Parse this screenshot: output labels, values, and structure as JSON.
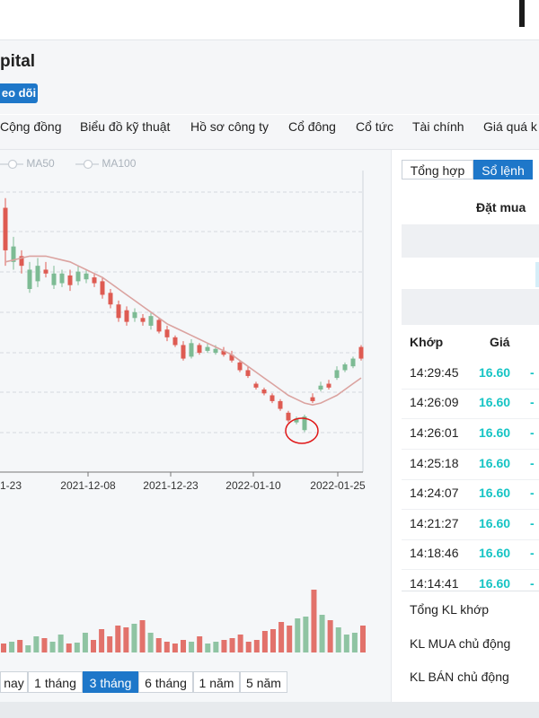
{
  "header": {
    "title_fragment": "pital",
    "follow_label": "eo dõi"
  },
  "nav": {
    "items": [
      "Cộng đồng",
      "Biểu đồ kỹ thuật",
      "Hồ sơ công ty",
      "Cổ đông",
      "Cổ tức",
      "Tài chính",
      "Giá quá k"
    ]
  },
  "legend": {
    "items": [
      "MA50",
      "MA100"
    ]
  },
  "chart_data": {
    "type": "candlestick",
    "x_ticks": [
      "1-23",
      "2021-12-08",
      "2021-12-23",
      "2022-01-10",
      "2022-01-25"
    ],
    "ylim": [
      0,
      100
    ],
    "grid": true,
    "candles": [
      {
        "o": 68,
        "c": 90,
        "h": 95,
        "l": 60,
        "up": false
      },
      {
        "o": 62,
        "c": 70,
        "h": 75,
        "l": 58,
        "up": true
      },
      {
        "o": 60,
        "c": 65,
        "h": 68,
        "l": 56,
        "up": false
      },
      {
        "o": 48,
        "c": 58,
        "h": 62,
        "l": 46,
        "up": true
      },
      {
        "o": 52,
        "c": 60,
        "h": 64,
        "l": 49,
        "up": true
      },
      {
        "o": 56,
        "c": 58,
        "h": 62,
        "l": 54,
        "up": false
      },
      {
        "o": 50,
        "c": 56,
        "h": 60,
        "l": 48,
        "up": true
      },
      {
        "o": 51,
        "c": 56,
        "h": 58,
        "l": 49,
        "up": true
      },
      {
        "o": 50,
        "c": 55,
        "h": 58,
        "l": 47,
        "up": false
      },
      {
        "o": 52,
        "c": 57,
        "h": 60,
        "l": 50,
        "up": true
      },
      {
        "o": 53,
        "c": 56,
        "h": 58,
        "l": 51,
        "up": true
      },
      {
        "o": 51,
        "c": 54,
        "h": 56,
        "l": 49,
        "up": false
      },
      {
        "o": 45,
        "c": 52,
        "h": 54,
        "l": 43,
        "up": false
      },
      {
        "o": 40,
        "c": 46,
        "h": 48,
        "l": 38,
        "up": false
      },
      {
        "o": 33,
        "c": 40,
        "h": 42,
        "l": 31,
        "up": false
      },
      {
        "o": 31,
        "c": 37,
        "h": 39,
        "l": 29,
        "up": false
      },
      {
        "o": 33,
        "c": 36,
        "h": 38,
        "l": 31,
        "up": true
      },
      {
        "o": 31,
        "c": 33,
        "h": 35,
        "l": 29,
        "up": false
      },
      {
        "o": 29,
        "c": 34,
        "h": 36,
        "l": 27,
        "up": true
      },
      {
        "o": 26,
        "c": 32,
        "h": 33,
        "l": 25,
        "up": false
      },
      {
        "o": 23,
        "c": 27,
        "h": 29,
        "l": 21,
        "up": false
      },
      {
        "o": 19,
        "c": 23,
        "h": 24,
        "l": 18,
        "up": false
      },
      {
        "o": 12,
        "c": 19,
        "h": 21,
        "l": 11,
        "up": false
      },
      {
        "o": 13,
        "c": 20,
        "h": 22,
        "l": 12,
        "up": true
      },
      {
        "o": 15,
        "c": 19,
        "h": 20,
        "l": 14,
        "up": false
      },
      {
        "o": 16,
        "c": 18,
        "h": 20,
        "l": 15,
        "up": true
      },
      {
        "o": 15,
        "c": 17,
        "h": 19,
        "l": 14,
        "up": true
      },
      {
        "o": 14,
        "c": 16,
        "h": 18,
        "l": 13,
        "up": false
      },
      {
        "o": 11,
        "c": 14,
        "h": 16,
        "l": 10,
        "up": false
      },
      {
        "o": 6,
        "c": 10,
        "h": 11,
        "l": 5,
        "up": false
      },
      {
        "o": 3,
        "c": 6,
        "h": 8,
        "l": 2,
        "up": false
      },
      {
        "o": -3,
        "c": -1,
        "h": 0,
        "l": -4,
        "up": false
      },
      {
        "o": -6,
        "c": -4,
        "h": -3,
        "l": -7,
        "up": false
      },
      {
        "o": -10,
        "c": -7,
        "h": -6,
        "l": -11,
        "up": false
      },
      {
        "o": -14,
        "c": -10,
        "h": -9,
        "l": -15,
        "up": false
      },
      {
        "o": -20,
        "c": -16,
        "h": -15,
        "l": -21,
        "up": false
      },
      {
        "o": -21,
        "c": -19,
        "h": -18,
        "l": -22,
        "up": true
      },
      {
        "o": -25,
        "c": -18,
        "h": -17,
        "l": -26,
        "up": true
      },
      {
        "o": -10,
        "c": -8,
        "h": -6,
        "l": -11,
        "up": false
      },
      {
        "o": -4,
        "c": -2,
        "h": 0,
        "l": -5,
        "up": true
      },
      {
        "o": -3,
        "c": -1,
        "h": 1,
        "l": -4,
        "up": false
      },
      {
        "o": 2,
        "c": 6,
        "h": 8,
        "l": 1,
        "up": true
      },
      {
        "o": 6,
        "c": 9,
        "h": 10,
        "l": 5,
        "up": true
      },
      {
        "o": 8,
        "c": 12,
        "h": 13,
        "l": 7,
        "up": true
      },
      {
        "o": 12,
        "c": 18,
        "h": 19,
        "l": 11,
        "up": false
      }
    ],
    "ma": [
      62,
      63,
      64,
      65,
      65,
      65,
      64,
      63,
      62,
      60,
      58,
      56,
      54,
      51,
      48,
      45,
      42,
      39,
      36,
      33,
      30,
      28,
      26,
      24,
      22,
      20,
      18,
      16,
      14,
      11,
      8,
      5,
      2,
      -1,
      -4,
      -7,
      -9,
      -11,
      -12,
      -11,
      -9,
      -7,
      -4,
      -1,
      2
    ],
    "volumes": [
      10,
      12,
      14,
      8,
      18,
      16,
      12,
      20,
      10,
      11,
      22,
      14,
      26,
      18,
      30,
      28,
      32,
      36,
      22,
      16,
      12,
      10,
      14,
      12,
      18,
      10,
      12,
      14,
      16,
      20,
      12,
      14,
      24,
      26,
      34,
      30,
      38,
      40,
      70,
      42,
      36,
      28,
      20,
      22,
      30
    ]
  },
  "range_buttons": {
    "items": [
      "nay",
      "1 tháng",
      "3 tháng",
      "6 tháng",
      "1 năm",
      "5 năm"
    ],
    "active": "3 tháng"
  },
  "side": {
    "tabs": [
      "Tổng hợp",
      "Sổ lệnh"
    ],
    "active_tab": "Sổ lệnh",
    "order_header": "Đặt mua",
    "trades_headers": [
      "Khớp",
      "Giá"
    ],
    "trades": [
      {
        "time": "14:29:45",
        "price": "16.60",
        "tick": "-"
      },
      {
        "time": "14:26:09",
        "price": "16.60",
        "tick": "-"
      },
      {
        "time": "14:26:01",
        "price": "16.60",
        "tick": "-"
      },
      {
        "time": "14:25:18",
        "price": "16.60",
        "tick": "-"
      },
      {
        "time": "14:24:07",
        "price": "16.60",
        "tick": "-"
      },
      {
        "time": "14:21:27",
        "price": "16.60",
        "tick": "-"
      },
      {
        "time": "14:18:46",
        "price": "16.60",
        "tick": "-"
      },
      {
        "time": "14:14:41",
        "price": "16.60",
        "tick": "-"
      }
    ],
    "summary": [
      "Tổng KL khớp",
      "KL MUA chủ động",
      "KL BÁN chủ động"
    ]
  },
  "colors": {
    "up": "#7dbb94",
    "down": "#de5b52",
    "ma": "#dba3a0",
    "accent": "#1e77c9",
    "price": "#16c4c4"
  }
}
